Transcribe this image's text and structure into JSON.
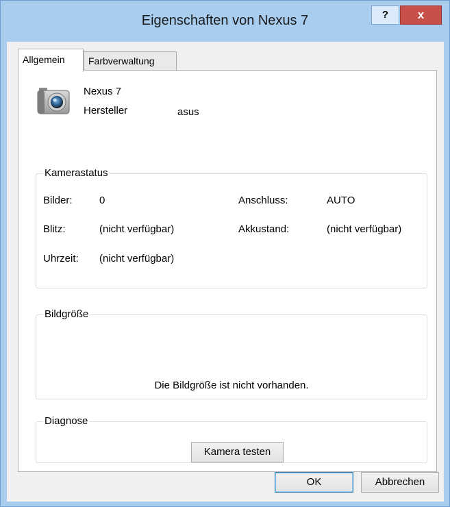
{
  "window": {
    "title": "Eigenschaften von Nexus 7",
    "help_label": "?",
    "close_label": "x"
  },
  "tabs": [
    {
      "label": "Allgemein",
      "active": true
    },
    {
      "label": "Farbverwaltung",
      "active": false
    }
  ],
  "device": {
    "icon": "camera-icon",
    "name": "Nexus 7",
    "manufacturer_label": "Hersteller",
    "manufacturer_value": "asus"
  },
  "camera_status": {
    "caption": "Kamerastatus",
    "images_label": "Bilder:",
    "images_value": "0",
    "flash_label": "Blitz:",
    "flash_value": "(nicht verfügbar)",
    "time_label": "Uhrzeit:",
    "time_value": "(nicht verfügbar)",
    "connection_label": "Anschluss:",
    "connection_value": "AUTO",
    "battery_label": "Akkustand:",
    "battery_value": "(nicht verfügbar)"
  },
  "image_size": {
    "caption": "Bildgröße",
    "message": "Die Bildgröße ist nicht vorhanden."
  },
  "diagnostics": {
    "caption": "Diagnose",
    "test_button": "Kamera testen"
  },
  "footer": {
    "ok_label": "OK",
    "cancel_label": "Abbrechen"
  }
}
